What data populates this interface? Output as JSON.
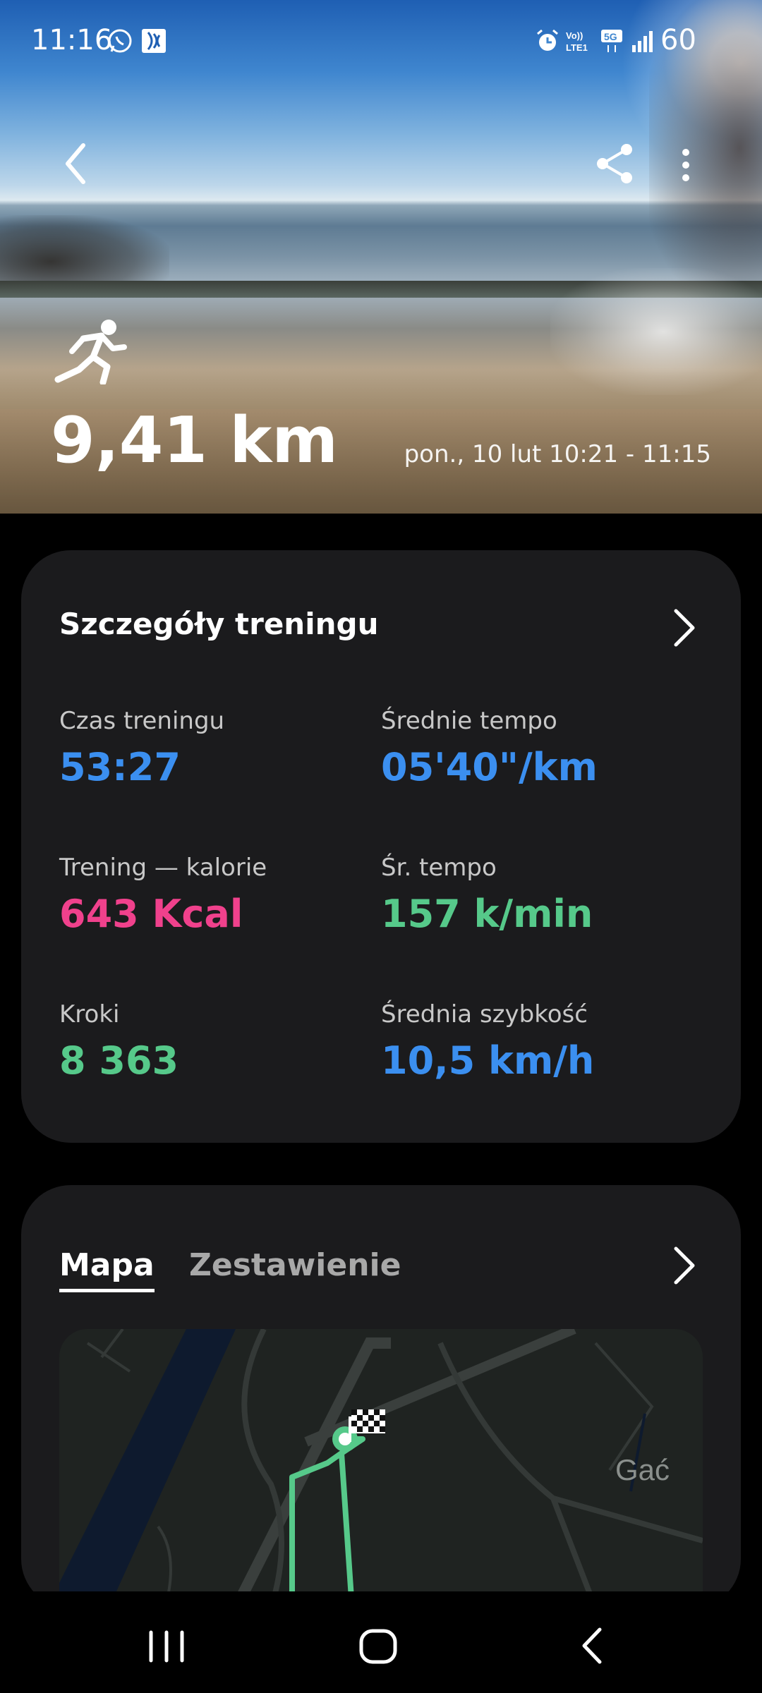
{
  "status_bar": {
    "time": "11:16",
    "battery": "60"
  },
  "hero": {
    "distance": "9,41 km",
    "date_range": "pon., 10 lut 10:21 - 11:15",
    "icons": [
      "back-arrow-icon",
      "share-icon",
      "more-options-icon",
      "running-icon"
    ]
  },
  "details_card": {
    "title": "Szczegóły treningu",
    "stats": [
      {
        "label": "Czas treningu",
        "value": "53:27",
        "color": "#3b8ff0"
      },
      {
        "label": "Średnie tempo",
        "value": "05'40\"/km",
        "color": "#3b8ff0"
      },
      {
        "label": "Trening — kalorie",
        "value": "643 Kcal",
        "color": "#f0418c"
      },
      {
        "label": "Śr. tempo",
        "value": "157 k/min",
        "color": "#56c98a"
      },
      {
        "label": "Kroki",
        "value": "8 363",
        "color": "#56c98a"
      },
      {
        "label": "Średnia szybkość",
        "value": "10,5 km/h",
        "color": "#3b8ff0"
      }
    ]
  },
  "map_card": {
    "tabs": [
      "Mapa",
      "Zestawienie"
    ],
    "active_tab": "Mapa",
    "map_label": "Gać",
    "route_color": "#56c98a"
  },
  "nav_bar": {
    "icons": [
      "recent-apps-icon",
      "home-icon",
      "back-icon"
    ]
  }
}
